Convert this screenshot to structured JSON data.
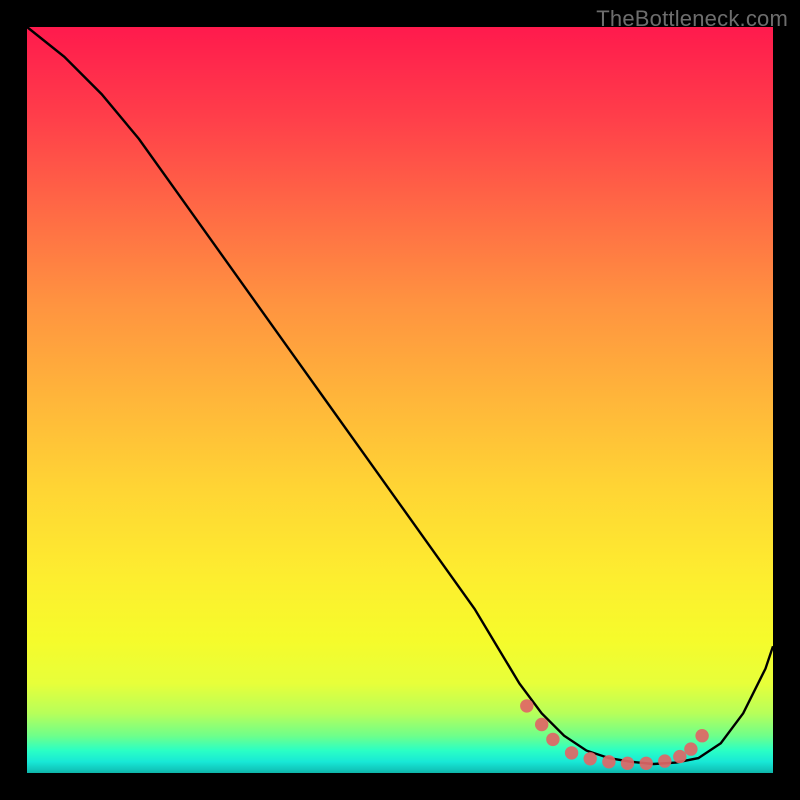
{
  "watermark": "TheBottleneck.com",
  "chart_data": {
    "type": "line",
    "title": "",
    "xlabel": "",
    "ylabel": "",
    "xlim": [
      0,
      100
    ],
    "ylim": [
      0,
      100
    ],
    "grid": false,
    "legend": false,
    "background_gradient": {
      "top": "#ff1a4d",
      "bottom": "#0fb3a8",
      "stops": [
        "red",
        "orange",
        "yellow",
        "green"
      ]
    },
    "series": [
      {
        "name": "bottleneck-curve",
        "color": "#000000",
        "x": [
          0,
          5,
          10,
          15,
          20,
          25,
          30,
          35,
          40,
          45,
          50,
          55,
          60,
          63,
          66,
          69,
          72,
          75,
          78,
          81,
          84,
          87,
          90,
          93,
          96,
          99,
          100
        ],
        "y_pct": [
          100,
          96,
          91,
          85,
          78,
          71,
          64,
          57,
          50,
          43,
          36,
          29,
          22,
          17,
          12,
          8,
          5,
          3,
          2,
          1.5,
          1.2,
          1.4,
          2,
          4,
          8,
          14,
          17
        ]
      }
    ],
    "markers": {
      "name": "optimal-zone",
      "color": "#e06666",
      "radius_pct": 0.9,
      "points": [
        {
          "x": 67,
          "y_pct": 9
        },
        {
          "x": 69,
          "y_pct": 6.5
        },
        {
          "x": 70.5,
          "y_pct": 4.5
        },
        {
          "x": 73,
          "y_pct": 2.7
        },
        {
          "x": 75.5,
          "y_pct": 1.9
        },
        {
          "x": 78,
          "y_pct": 1.5
        },
        {
          "x": 80.5,
          "y_pct": 1.3
        },
        {
          "x": 83,
          "y_pct": 1.3
        },
        {
          "x": 85.5,
          "y_pct": 1.6
        },
        {
          "x": 87.5,
          "y_pct": 2.2
        },
        {
          "x": 89,
          "y_pct": 3.2
        },
        {
          "x": 90.5,
          "y_pct": 5
        }
      ]
    }
  }
}
